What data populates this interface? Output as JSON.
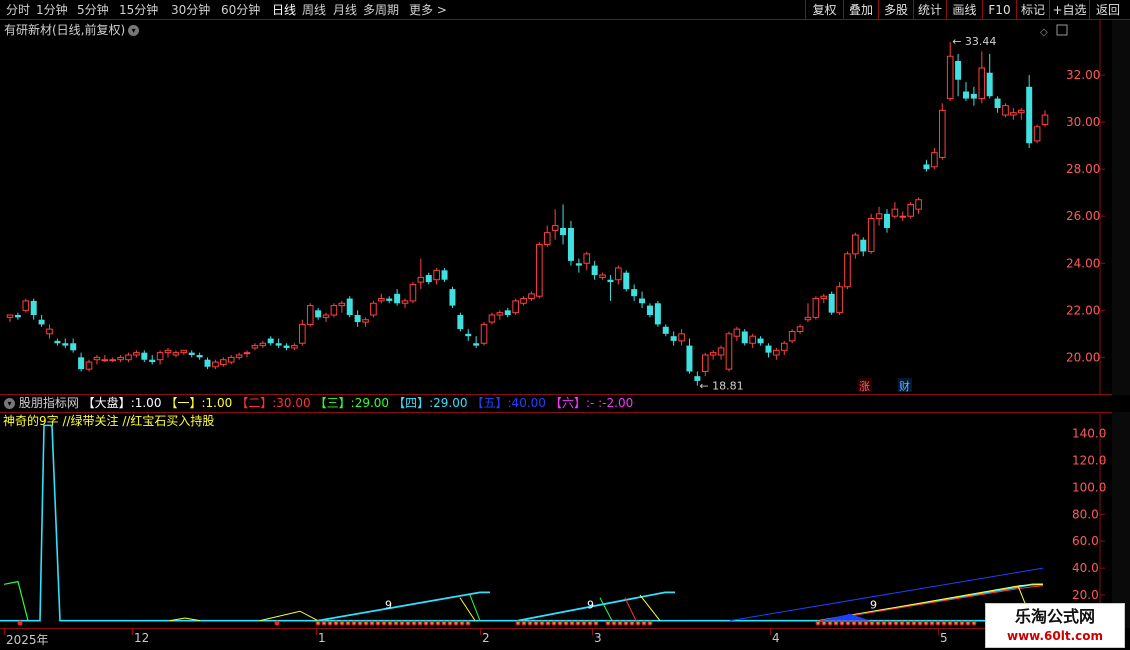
{
  "toolbar": {
    "periods": [
      "分时",
      "1分钟",
      "5分钟",
      "15分钟",
      "30分钟",
      "60分钟",
      "日线",
      "周线",
      "月线",
      "多周期",
      "更多 >"
    ],
    "active_period": "日线",
    "buttons": [
      "复权",
      "叠加",
      "多股",
      "统计",
      "画线",
      "F10",
      "标记",
      "+自选",
      "返回"
    ]
  },
  "price_pane": {
    "title": "有研新材(日线,前复权)",
    "dropdown_icon": "chevron-down-icon",
    "high_label": "33.44",
    "low_label": "18.81",
    "y_ticks": [
      "32.00",
      "30.00",
      "28.00",
      "26.00",
      "24.00",
      "22.00",
      "20.00"
    ],
    "markers": [
      "涨",
      "财"
    ]
  },
  "indicator": {
    "name": "股朋指标网",
    "params": [
      {
        "label": "【大盘】",
        "value": ":1.00",
        "color": "#ffffff"
      },
      {
        "label": "【一】",
        "value": ":1.00",
        "color": "#ffff30"
      },
      {
        "label": "【二】",
        "value": ":30.00",
        "color": "#ff3030"
      },
      {
        "label": "【三】",
        "value": ":29.00",
        "color": "#30ff30"
      },
      {
        "label": "【四】",
        "value": ":29.00",
        "color": "#30e0ff"
      },
      {
        "label": "【五】",
        "value": ":40.00",
        "color": "#2040ff"
      },
      {
        "label": "【六】",
        "value": ":- :-2.00",
        "color": "#ff30ff"
      }
    ],
    "subtitle": "神奇的9字 //绿带关注 //红宝石买入持股",
    "y_ticks": [
      "140.0",
      "120.0",
      "100.0",
      "80.0",
      "60.0",
      "40.0",
      "20.0"
    ],
    "digit_marks": [
      "9",
      "9",
      "9"
    ]
  },
  "date_axis": {
    "labels": [
      "2025年",
      "12",
      "1",
      "2",
      "3",
      "4",
      "5"
    ]
  },
  "watermark": {
    "line1": "乐淘公式网",
    "line2": "www.60lt.com"
  },
  "colors": {
    "up": "#ff4040",
    "down": "#40e0e0",
    "axis": "#ff5a5a",
    "grid": "#8a1010"
  },
  "chart_data": {
    "type": "candlestick",
    "ylim": [
      18.4,
      34.0
    ],
    "candles": [
      [
        21.7,
        21.8,
        21.5,
        21.8
      ],
      [
        21.8,
        21.9,
        21.6,
        21.7
      ],
      [
        22.0,
        22.5,
        21.9,
        22.4
      ],
      [
        22.4,
        22.5,
        21.6,
        21.8
      ],
      [
        21.6,
        21.8,
        21.3,
        21.4
      ],
      [
        21.0,
        21.4,
        20.8,
        21.2
      ],
      [
        20.7,
        20.8,
        20.5,
        20.6
      ],
      [
        20.6,
        20.8,
        20.4,
        20.5
      ],
      [
        20.6,
        20.8,
        20.2,
        20.3
      ],
      [
        20.0,
        20.2,
        19.4,
        19.5
      ],
      [
        19.5,
        19.9,
        19.4,
        19.8
      ],
      [
        19.9,
        20.1,
        19.7,
        20.0
      ],
      [
        19.9,
        20.1,
        19.8,
        19.9
      ],
      [
        19.9,
        20.0,
        19.8,
        19.9
      ],
      [
        19.9,
        20.1,
        19.8,
        20.0
      ],
      [
        19.9,
        20.2,
        19.8,
        20.1
      ],
      [
        20.1,
        20.3,
        20.0,
        20.2
      ],
      [
        20.2,
        20.3,
        19.8,
        19.9
      ],
      [
        19.9,
        20.1,
        19.7,
        19.8
      ],
      [
        19.9,
        20.3,
        19.7,
        20.2
      ],
      [
        20.2,
        20.4,
        20.0,
        20.3
      ],
      [
        20.1,
        20.3,
        20.0,
        20.2
      ],
      [
        20.2,
        20.3,
        20.1,
        20.3
      ],
      [
        20.2,
        20.3,
        20.0,
        20.1
      ],
      [
        20.1,
        20.2,
        19.9,
        20.0
      ],
      [
        19.9,
        20.0,
        19.5,
        19.6
      ],
      [
        19.6,
        19.9,
        19.5,
        19.8
      ],
      [
        19.7,
        20.0,
        19.6,
        19.9
      ],
      [
        19.8,
        20.1,
        19.7,
        20.0
      ],
      [
        20.0,
        20.2,
        19.9,
        20.1
      ],
      [
        20.2,
        20.3,
        20.0,
        20.2
      ],
      [
        20.4,
        20.6,
        20.3,
        20.5
      ],
      [
        20.5,
        20.7,
        20.4,
        20.6
      ],
      [
        20.8,
        20.9,
        20.5,
        20.6
      ],
      [
        20.6,
        20.8,
        20.4,
        20.5
      ],
      [
        20.5,
        20.6,
        20.3,
        20.4
      ],
      [
        20.4,
        20.6,
        20.3,
        20.5
      ],
      [
        20.6,
        21.6,
        20.5,
        21.4
      ],
      [
        21.4,
        22.3,
        21.3,
        22.2
      ],
      [
        22.0,
        22.1,
        21.6,
        21.7
      ],
      [
        21.7,
        21.9,
        21.5,
        21.8
      ],
      [
        21.8,
        22.3,
        21.7,
        22.2
      ],
      [
        22.2,
        22.4,
        21.9,
        22.3
      ],
      [
        22.5,
        22.6,
        21.7,
        21.8
      ],
      [
        21.8,
        22.0,
        21.3,
        21.5
      ],
      [
        21.5,
        21.7,
        21.3,
        21.6
      ],
      [
        21.8,
        22.4,
        21.7,
        22.3
      ],
      [
        22.4,
        22.7,
        22.3,
        22.5
      ],
      [
        22.5,
        22.6,
        22.3,
        22.4
      ],
      [
        22.7,
        22.9,
        22.2,
        22.3
      ],
      [
        22.3,
        22.5,
        22.1,
        22.4
      ],
      [
        22.4,
        23.2,
        22.3,
        23.1
      ],
      [
        23.2,
        24.2,
        22.9,
        23.4
      ],
      [
        23.5,
        23.6,
        23.1,
        23.2
      ],
      [
        23.3,
        23.8,
        23.1,
        23.7
      ],
      [
        23.7,
        23.8,
        23.2,
        23.3
      ],
      [
        22.9,
        23.0,
        22.1,
        22.2
      ],
      [
        21.8,
        21.9,
        21.1,
        21.2
      ],
      [
        21.0,
        21.2,
        20.7,
        20.9
      ],
      [
        20.6,
        20.9,
        20.4,
        20.5
      ],
      [
        20.6,
        21.5,
        20.5,
        21.4
      ],
      [
        21.5,
        21.9,
        21.4,
        21.8
      ],
      [
        21.8,
        22.0,
        21.6,
        21.9
      ],
      [
        22.0,
        22.1,
        21.7,
        21.8
      ],
      [
        21.9,
        22.5,
        21.8,
        22.4
      ],
      [
        22.3,
        22.6,
        22.2,
        22.5
      ],
      [
        22.5,
        22.8,
        22.4,
        22.7
      ],
      [
        22.6,
        24.9,
        22.5,
        24.8
      ],
      [
        24.8,
        25.6,
        24.7,
        25.3
      ],
      [
        25.4,
        26.3,
        25.0,
        25.6
      ],
      [
        25.5,
        26.5,
        24.8,
        25.2
      ],
      [
        25.5,
        25.8,
        23.9,
        24.1
      ],
      [
        24.0,
        24.2,
        23.6,
        23.9
      ],
      [
        24.0,
        24.5,
        23.7,
        24.4
      ],
      [
        23.9,
        24.1,
        23.3,
        23.5
      ],
      [
        23.4,
        23.6,
        23.3,
        23.5
      ],
      [
        23.3,
        23.5,
        22.4,
        23.2
      ],
      [
        23.3,
        23.9,
        23.1,
        23.8
      ],
      [
        23.6,
        23.7,
        22.8,
        22.9
      ],
      [
        22.9,
        23.1,
        22.4,
        22.6
      ],
      [
        22.5,
        22.8,
        22.1,
        22.3
      ],
      [
        22.2,
        22.3,
        21.7,
        21.8
      ],
      [
        22.3,
        22.4,
        21.3,
        21.4
      ],
      [
        21.3,
        21.4,
        20.9,
        21.0
      ],
      [
        20.9,
        21.1,
        20.5,
        20.7
      ],
      [
        20.7,
        21.2,
        20.5,
        21.0
      ],
      [
        20.5,
        20.8,
        19.3,
        19.4
      ],
      [
        19.2,
        19.4,
        18.8,
        19.0
      ],
      [
        19.4,
        20.2,
        19.2,
        20.1
      ],
      [
        20.1,
        20.3,
        19.9,
        20.2
      ],
      [
        20.1,
        20.5,
        19.9,
        20.4
      ],
      [
        19.5,
        21.1,
        19.4,
        21.0
      ],
      [
        20.9,
        21.3,
        20.7,
        21.2
      ],
      [
        21.1,
        21.2,
        20.5,
        20.6
      ],
      [
        20.6,
        21.0,
        20.4,
        20.9
      ],
      [
        20.8,
        20.9,
        20.5,
        20.6
      ],
      [
        20.5,
        20.6,
        20.0,
        20.2
      ],
      [
        20.1,
        20.4,
        19.9,
        20.3
      ],
      [
        20.3,
        20.7,
        20.1,
        20.6
      ],
      [
        20.7,
        21.2,
        20.6,
        21.1
      ],
      [
        21.1,
        21.4,
        21.0,
        21.3
      ],
      [
        21.6,
        22.3,
        21.5,
        21.7
      ],
      [
        21.7,
        22.6,
        21.6,
        22.5
      ],
      [
        22.5,
        22.7,
        22.3,
        22.6
      ],
      [
        22.7,
        22.8,
        21.8,
        21.9
      ],
      [
        21.9,
        23.2,
        21.8,
        23.0
      ],
      [
        23.0,
        24.5,
        22.9,
        24.4
      ],
      [
        24.4,
        25.3,
        24.2,
        25.2
      ],
      [
        25.0,
        25.1,
        24.3,
        24.5
      ],
      [
        24.5,
        26.1,
        24.4,
        25.9
      ],
      [
        25.9,
        26.4,
        25.6,
        26.1
      ],
      [
        26.1,
        26.3,
        25.3,
        25.5
      ],
      [
        26.0,
        26.6,
        25.9,
        26.3
      ],
      [
        26.0,
        26.2,
        25.8,
        26.0
      ],
      [
        26.0,
        26.6,
        25.9,
        26.5
      ],
      [
        26.3,
        26.8,
        26.1,
        26.7
      ],
      [
        28.2,
        28.4,
        27.9,
        28.0
      ],
      [
        28.1,
        28.9,
        28.0,
        28.7
      ],
      [
        28.5,
        30.8,
        28.4,
        30.5
      ],
      [
        31.0,
        33.4,
        30.9,
        32.8
      ],
      [
        32.6,
        32.9,
        31.1,
        31.8
      ],
      [
        31.3,
        31.7,
        30.9,
        31.0
      ],
      [
        31.2,
        31.5,
        30.7,
        31.0
      ],
      [
        31.0,
        33.0,
        30.8,
        32.3
      ],
      [
        32.1,
        32.9,
        31.0,
        31.1
      ],
      [
        31.0,
        31.1,
        30.4,
        30.6
      ],
      [
        30.3,
        30.8,
        30.2,
        30.7
      ],
      [
        30.3,
        30.6,
        30.1,
        30.4
      ],
      [
        30.4,
        30.6,
        30.1,
        30.5
      ],
      [
        31.5,
        32.0,
        28.9,
        29.1
      ],
      [
        29.2,
        29.9,
        29.1,
        29.8
      ],
      [
        29.9,
        30.5,
        29.8,
        30.3
      ]
    ],
    "indicator_lines": [
      {
        "name": "yellow",
        "color": "#ffff30"
      },
      {
        "name": "red",
        "color": "#ff3030"
      },
      {
        "name": "green",
        "color": "#30ff30"
      },
      {
        "name": "cyan",
        "color": "#30e0ff"
      },
      {
        "name": "blue",
        "color": "#2040ff"
      }
    ]
  }
}
